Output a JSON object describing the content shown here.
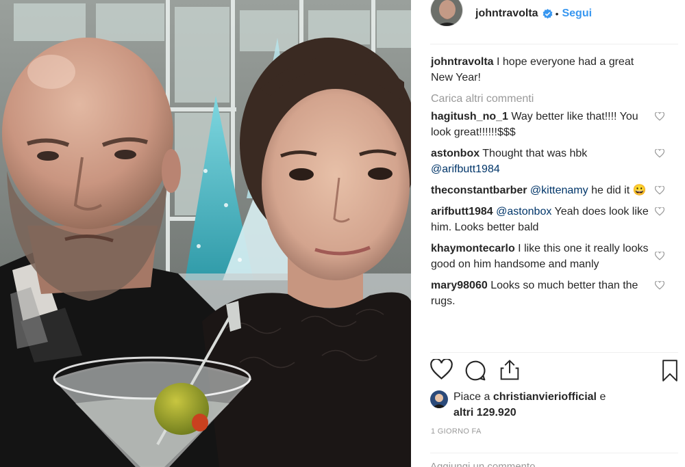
{
  "post": {
    "username": "johntravolta",
    "verified": true,
    "separator": "•",
    "follow_label": "Segui",
    "caption_user": "johntravolta",
    "caption_text": "I hope everyone had a great New Year!",
    "load_more_label": "Carica altri commenti",
    "likes_prefix": "Piace a",
    "likes_user": "christianvieriofficial",
    "likes_suffix": "e",
    "likes_others": "altri 129.920",
    "timestamp": "1 giorno fa",
    "add_comment_placeholder": "Aggiungi un commento..."
  },
  "comments": [
    {
      "user": "hagitush_no_1",
      "text": "Way better like that!!!! You look great!!!!!!$$$"
    },
    {
      "user": "astonbox",
      "text": "Thought that was hbk",
      "mention": "@arifbutt1984",
      "after": ""
    },
    {
      "user": "theconstantbarber",
      "mention": "@kittenamy",
      "text": "he did it",
      "emoji": "😀"
    },
    {
      "user": "arifbutt1984",
      "mention": "@astonbox",
      "text": "Yeah does look like him. Looks better bald"
    },
    {
      "user": "khaymontecarlo",
      "text": "I like this one it really looks good on him handsome and manly"
    },
    {
      "user": "mary98060",
      "text": "Looks so much better than the rugs."
    }
  ],
  "colors": {
    "link_blue": "#3897f0",
    "text": "#262626",
    "muted": "#999999",
    "mention": "#003569"
  },
  "icons": [
    "verified-badge-icon",
    "heart-icon",
    "comment-icon",
    "share-icon",
    "bookmark-icon",
    "small-heart-icon"
  ]
}
